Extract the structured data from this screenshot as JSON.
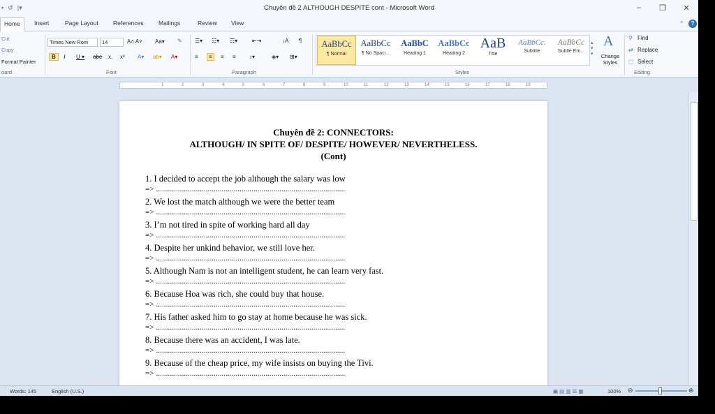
{
  "window": {
    "title": "Chuyên đề 2 ALTHOUGH DESPITE  cont - Microsoft Word"
  },
  "tabs": [
    "Home",
    "Insert",
    "Page Layout",
    "References",
    "Mailings",
    "Review",
    "View"
  ],
  "ribbon": {
    "clipboard": {
      "cut": "Cut",
      "copy": "Copy",
      "format_painter": "Format Painter",
      "group": "oard"
    },
    "font": {
      "name": "Times New Rom",
      "size": "14",
      "group": "Font"
    },
    "paragraph": {
      "group": "Paragraph"
    },
    "styles": {
      "group": "Styles",
      "items": [
        {
          "sample": "AaBbCc",
          "name": "¶ Normal"
        },
        {
          "sample": "AaBbCc",
          "name": "¶ No Spaci..."
        },
        {
          "sample": "AaBbC",
          "name": "Heading 1"
        },
        {
          "sample": "AaBbCc",
          "name": "Heading 2"
        },
        {
          "sample": "AaB",
          "name": "Title"
        },
        {
          "sample": "AaBbCc.",
          "name": "Subtitle"
        },
        {
          "sample": "AaBbCc",
          "name": "Subtle Em..."
        }
      ],
      "change_styles": "Change Styles"
    },
    "editing": {
      "find": "Find",
      "replace": "Replace",
      "select": "Select",
      "group": "Editing"
    }
  },
  "document": {
    "title": "Chuyên đề 2: CONNECTORS:",
    "subtitle": "ALTHOUGH/ IN SPITE OF/ DESPITE/ HOWEVER/ NEVERTHELESS.",
    "cont": "(Cont)",
    "answer_line": "=> ...............................................................................................",
    "items": [
      "1. I decided to accept the job although the salary  was low",
      "2. We lost the match although we were the better team",
      "3. I’m not tired in spite of working hard all day",
      "4. Despite her unkind behavior, we still love her.",
      "5. Although Nam is not an intelligent student, he can learn very fast.",
      "6. Because Hoa was rich, she could buy that house.",
      "7. His father asked him to go stay at home because he was sick.",
      "8. Because there was an accident, I was late.",
      "9. Because of the cheap price, my wife insists on buying the Tivi."
    ]
  },
  "status": {
    "words": "Words: 145",
    "language": "English (U.S.)",
    "zoom": "100%"
  }
}
